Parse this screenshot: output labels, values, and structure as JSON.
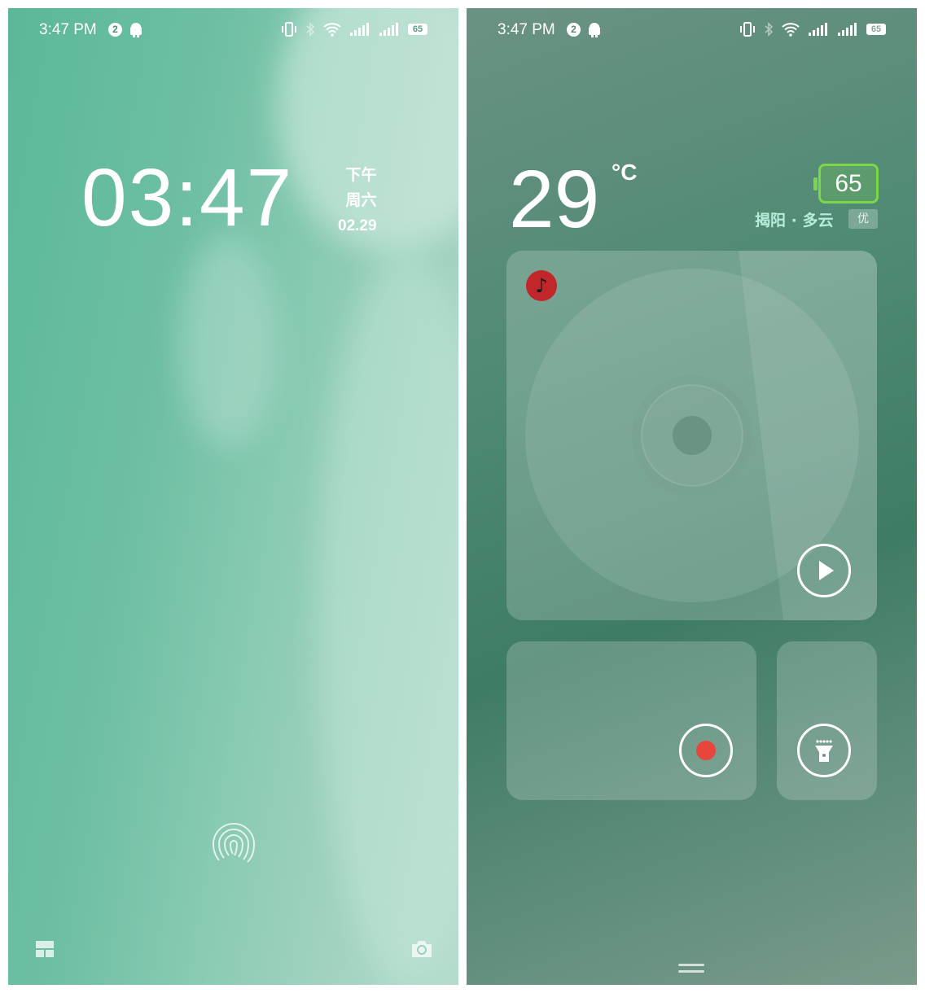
{
  "status_bar": {
    "time": "3:47 PM",
    "notification_count": "2",
    "battery_level": "65",
    "icons": [
      "vibrate-icon",
      "bluetooth-icon",
      "wifi-icon",
      "signal-1-icon",
      "signal-2-icon",
      "battery-icon"
    ]
  },
  "lock_screen": {
    "clock": "03:47",
    "period": "下午",
    "weekday": "周六",
    "date": "02.29",
    "icons": [
      "fingerprint-icon",
      "widgets-icon",
      "camera-icon"
    ]
  },
  "widgets_screen": {
    "temperature": "29",
    "temperature_unit": "°C",
    "battery": "65",
    "location_weather": "揭阳 · 多云",
    "air_quality": "优",
    "music_card": {
      "icon": "music-note-icon",
      "control": "play-icon"
    },
    "recorder_card": {
      "control": "record-icon"
    },
    "flashlight_card": {
      "control": "flashlight-icon"
    }
  },
  "colors": {
    "battery_accent": "#7cd64a",
    "record_red": "#e8453c",
    "music_badge": "#c0262a"
  }
}
